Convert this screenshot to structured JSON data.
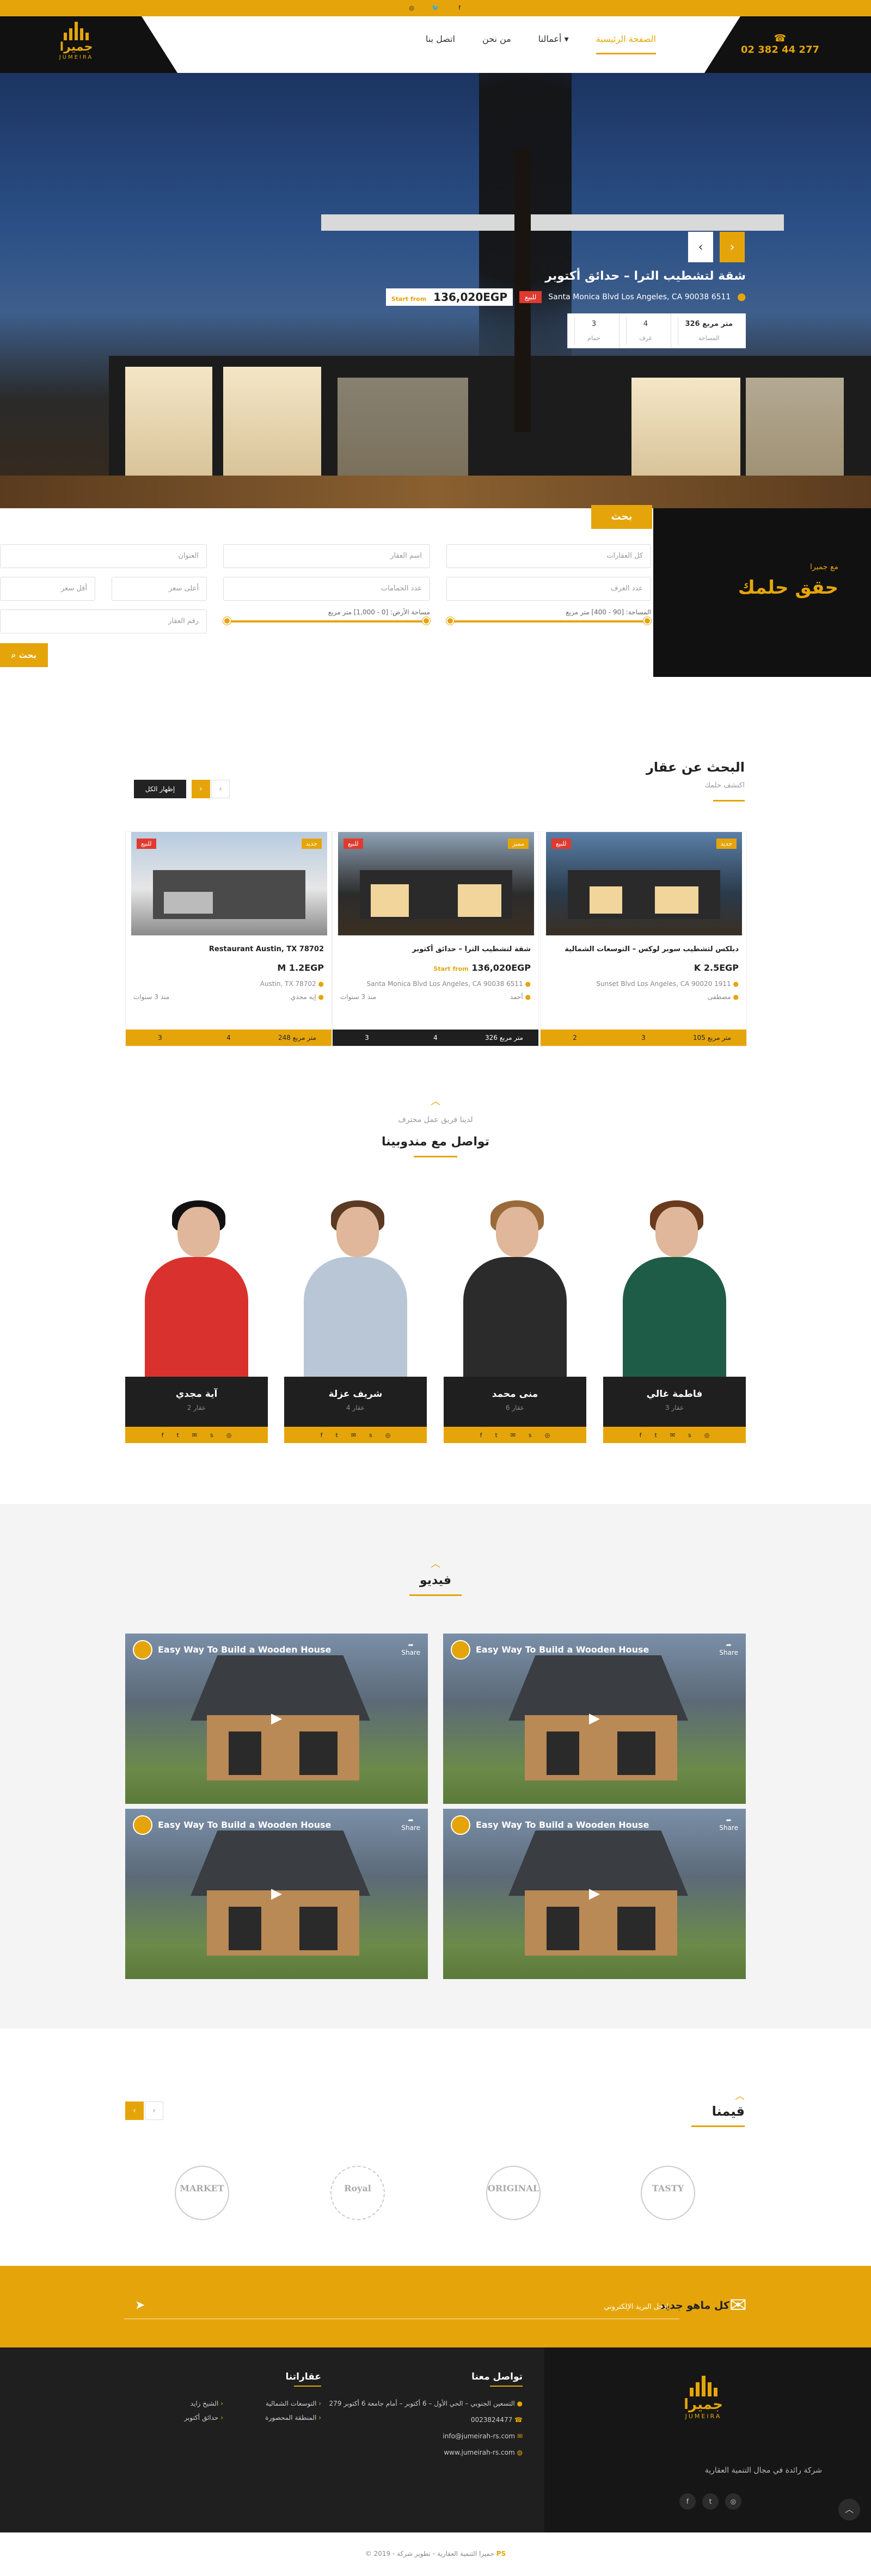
{
  "topbar": {
    "icons": [
      "instagram-icon",
      "twitter-icon",
      "facebook-icon"
    ]
  },
  "header": {
    "logo_ar": "جميرا",
    "logo_en": "JUMEIRA",
    "phone": "02 382 44 277",
    "menu": [
      {
        "label": "الصفحة الرئيسية",
        "active": true
      },
      {
        "label": "أعمالنا",
        "dropdown": true
      },
      {
        "label": "من نحن"
      },
      {
        "label": "اتصل بنا"
      }
    ]
  },
  "hero": {
    "title": "شقة لتشطيب الترا – حدائق أكتوبر",
    "address": "Santa Monica Blvd Los Angeles, CA 90038 6511",
    "badge": "للبيع",
    "price_prefix": "Start from",
    "price": "136,020EGP",
    "area_value": "326 متر مربع",
    "area_label": "المساحة",
    "rooms_value": "4",
    "rooms_label": "غرف",
    "baths_value": "3",
    "baths_label": "حمام"
  },
  "search": {
    "tag": "بحث",
    "fields": {
      "all_properties": "كل العقارات",
      "property_name": "اسم العقار",
      "location": "العنوان",
      "rooms": "عدد الغرف",
      "baths": "عدد الحمامات",
      "min_price": "أقل سعر",
      "max_price": "أعلى سعر",
      "property_id": "رقم العقار"
    },
    "area_slider": "المساحة: [90 - 400] متر مربع",
    "land_slider": "مساحة الأرض: [0 - 1,000] متر مربع",
    "button": "بحث",
    "side_small": "مع جميرا",
    "side_big": "حقق حلمك"
  },
  "listings": {
    "title": "البحث عن عقار",
    "subtitle": "اكتشف حلمك",
    "view_all": "إظهار الكل",
    "items": [
      {
        "title": "دبلكس لتشطيب سوبر لوكس – التوسعات الشمالية",
        "price": "K 2.5EGP",
        "price_suffix": "",
        "address": "Sunset Blvd Los Angeles, CA 90020 1911",
        "agent": "مصطفى",
        "labels": [
          "للبيع",
          "جديد"
        ],
        "area": "105 متر مربع",
        "rooms": "3",
        "baths": "2"
      },
      {
        "title": "شقة لتشطيب الترا – حدائق أكتوبر",
        "price": "136,020EGP",
        "price_suffix": "Start from",
        "address": "Santa Monica Blvd Los Angeles, CA 90038 6511",
        "agent": "أحمد",
        "date": "منذ 3 سنوات",
        "labels": [
          "للبيع",
          "مميز"
        ],
        "area": "326 متر مربع",
        "rooms": "4",
        "baths": "3"
      },
      {
        "title": "Restaurant Austin, TX 78702",
        "price": "M 1.2EGP",
        "price_suffix": "",
        "address": "Austin, TX 78702",
        "agent": "إيه مجدي",
        "date": "منذ 3 سنوات",
        "labels": [
          "للبيع",
          "جديد"
        ],
        "area": "248 متر مربع",
        "rooms": "4",
        "baths": "3"
      }
    ]
  },
  "agents": {
    "kicker": "لدينا فريق عمل محترف",
    "title": "تواصل مع مندوبينا",
    "items": [
      {
        "name": "فاطمة غالي",
        "role": "3 عقار"
      },
      {
        "name": "منى محمد",
        "role": "6 عقار"
      },
      {
        "name": "شريف عزلة",
        "role": "4 عقار"
      },
      {
        "name": "آية مجدي",
        "role": "2 عقار"
      }
    ]
  },
  "videos": {
    "title": "فيديو",
    "items": [
      {
        "title": "Easy Way To Build a Wooden House",
        "share": "Share"
      },
      {
        "title": "Easy Way To Build a Wooden House",
        "share": "Share"
      },
      {
        "title": "Easy Way To Build a Wooden House",
        "share": "Share"
      },
      {
        "title": "Easy Way To Build a Wooden House",
        "share": "Share"
      }
    ]
  },
  "clients": {
    "title": "قيمنا",
    "logos": [
      "TASTY",
      "ORIGINAL",
      "Royal",
      "MARKET"
    ]
  },
  "newsletter": {
    "label": "كل ماهو جديد",
    "placeholder": "ادخل البريد الإلكتروني"
  },
  "footer": {
    "contact_title": "تواصل معنا",
    "contact": {
      "address": "279 التسعين الجنوبي – الحي الأول – 6 أكتوبر – أمام جامعة 6 أكتوبر",
      "phone": "0023824477",
      "email": "info@jumeirah-rs.com",
      "website": "www.jumeirah-rs.com"
    },
    "properties_title": "عقاراتنا",
    "properties_col1": [
      "التوسعات الشمالية",
      "المنطقة المحصورة"
    ],
    "properties_col2": [
      "الشيخ زايد",
      "حدائق أكتوبر"
    ],
    "logo_ar": "جميرا",
    "logo_en": "JUMEIRA",
    "description": "شركة رائدة في مجال التنمية العقارية",
    "social": [
      "facebook-icon",
      "twitter-icon",
      "instagram-icon"
    ]
  },
  "copyright": {
    "text": "© 2019 - جميرا التنمية العقارية - تطوير شركة",
    "brand": "PS"
  },
  "colors": {
    "accent": "#e5a50a",
    "dark": "#111111",
    "red": "#e03a2f"
  }
}
